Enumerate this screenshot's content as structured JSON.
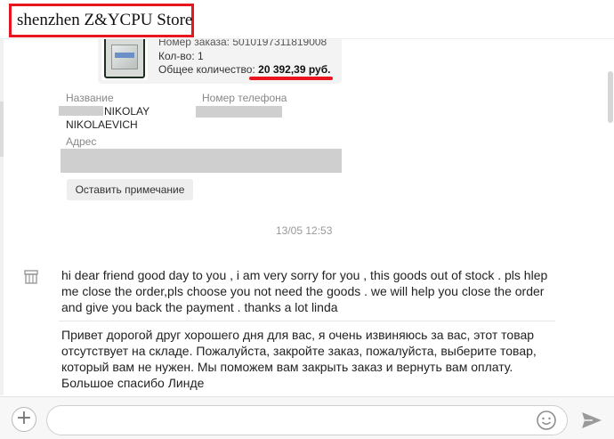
{
  "header": {
    "store_name": "shenzhen Z&YCPU Store"
  },
  "order": {
    "order_number_line": "Номер заказа: 5010197311819008",
    "quantity_line": "Кол-во: 1",
    "total_label": "Общее количество:",
    "total_value": "20 392,39 руб."
  },
  "address_card": {
    "name_label": "Название",
    "name_value_line1": "NIKOLAY",
    "name_value_line2": "NIKOLAEVICH",
    "phone_label": "Номер телефона",
    "address_label": "Адрес",
    "note_button": "Оставить примечание"
  },
  "conversation": {
    "timestamp": "13/05 12:53",
    "message_en": "hi dear friend good day to you , i am very sorry for you , this goods out of stock . pls hlep me close the order,pls choose you not need the goods . we will help you close the order and give you back the payment . thanks a lot linda",
    "message_ru": "Привет дорогой друг хорошего дня для вас, я очень извиняюсь за вас, этот товар отсутствует на складе. Пожалуйста, закройте заказ, пожалуйста, выберите товар, который вам не нужен. Мы поможем вам закрыть заказ и вернуть вам оплату. Большое спасибо Линде"
  },
  "composer": {
    "input_value": "",
    "icons": [
      "plus-icon",
      "smiley-icon",
      "send-icon"
    ]
  },
  "colors": {
    "highlight_red": "#e8141e",
    "send_icon": "#9a9a9a"
  }
}
